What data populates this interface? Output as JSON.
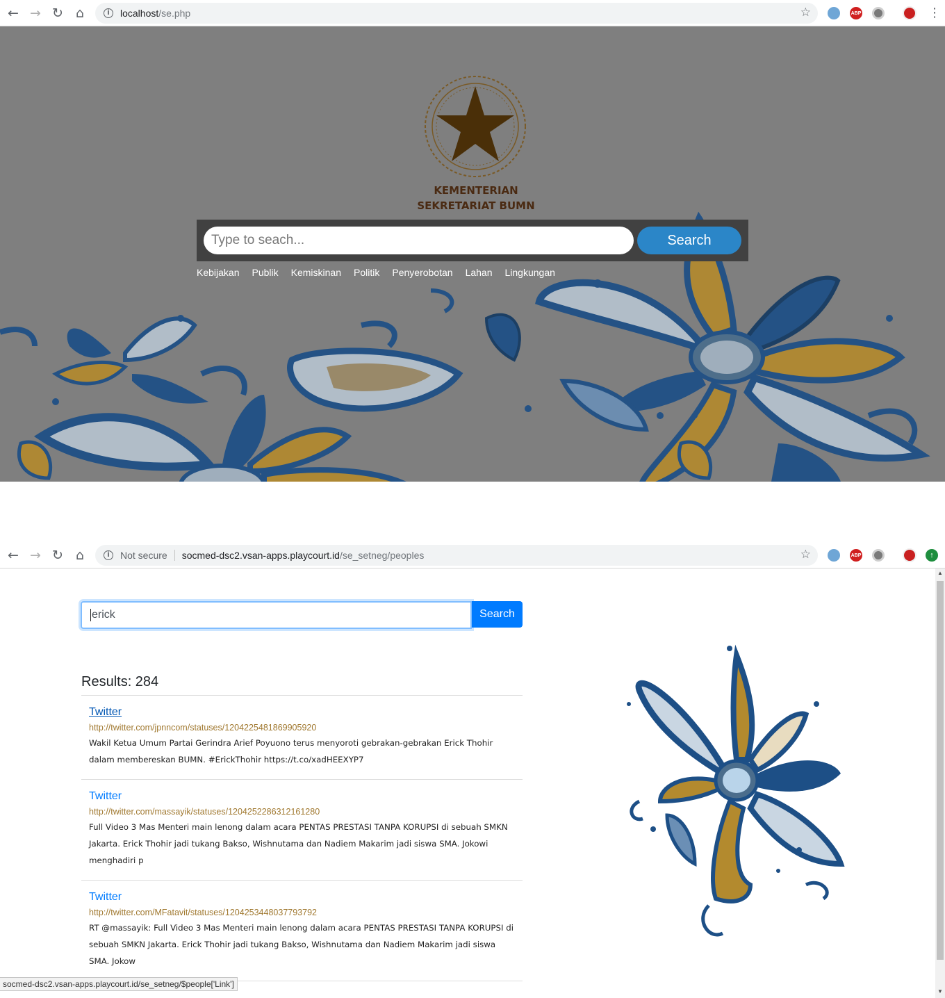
{
  "shot1": {
    "url_host": "localhost",
    "url_path": "/se.php",
    "extensions": [
      "cloud-icon",
      "ABP",
      "circle-icon",
      "avatar"
    ],
    "ministry_line1": "KEMENTERIAN",
    "ministry_line2": "SEKRETARIAT BUMN",
    "search_placeholder": "Type to seach...",
    "search_button": "Search",
    "categories": [
      "Kebijakan",
      "Publik",
      "Kemiskinan",
      "Politik",
      "Penyerobotan",
      "Lahan",
      "Lingkungan"
    ]
  },
  "shot2": {
    "not_secure": "Not secure",
    "url_host": "socmed-dsc2.vsan-apps.playcourt.id",
    "url_path": "/se_setneg/peoples",
    "search_value": "erick",
    "search_button": "Search",
    "results_label": "Results: 284",
    "results": [
      {
        "title": "Twitter",
        "url": "http://twitter.com/jpnncom/statuses/1204225481869905920",
        "text": "Wakil Ketua Umum Partai Gerindra Arief Poyuono terus menyoroti gebrakan-gebrakan Erick Thohir dalam membereskan BUMN. #ErickThohir https://t.co/xadHEEXYP7"
      },
      {
        "title": "Twitter",
        "url": "http://twitter.com/massayik/statuses/1204252286312161280",
        "text": "Full Video 3 Mas Menteri main lenong dalam acara PENTAS PRESTASI TANPA KORUPSI di sebuah SMKN Jakarta. Erick Thohir jadi tukang Bakso, Wishnutama dan Nadiem Makarim jadi siswa SMA. Jokowi menghadiri p"
      },
      {
        "title": "Twitter",
        "url": "http://twitter.com/MFatavit/statuses/1204253448037793792",
        "text": "RT @massayik: Full Video 3 Mas Menteri main lenong dalam acara PENTAS PRESTASI TANPA KORUPSI di sebuah SMKN Jakarta. Erick Thohir jadi tukang Bakso, Wishnutama dan Nadiem Makarim jadi siswa SMA. Jokow"
      }
    ],
    "status_url": "socmed-dsc2.vsan-apps.playcourt.id/se_setneg/$people['Link']"
  },
  "colors": {
    "hero_bg": "#7f7f7f",
    "hero_button": "#2b86c8",
    "primary": "#007bff",
    "url_gold": "#a0782f",
    "emblem_brown": "#4a2f08",
    "batik_blue": "#1d4f86",
    "batik_gold": "#b38a2e"
  }
}
